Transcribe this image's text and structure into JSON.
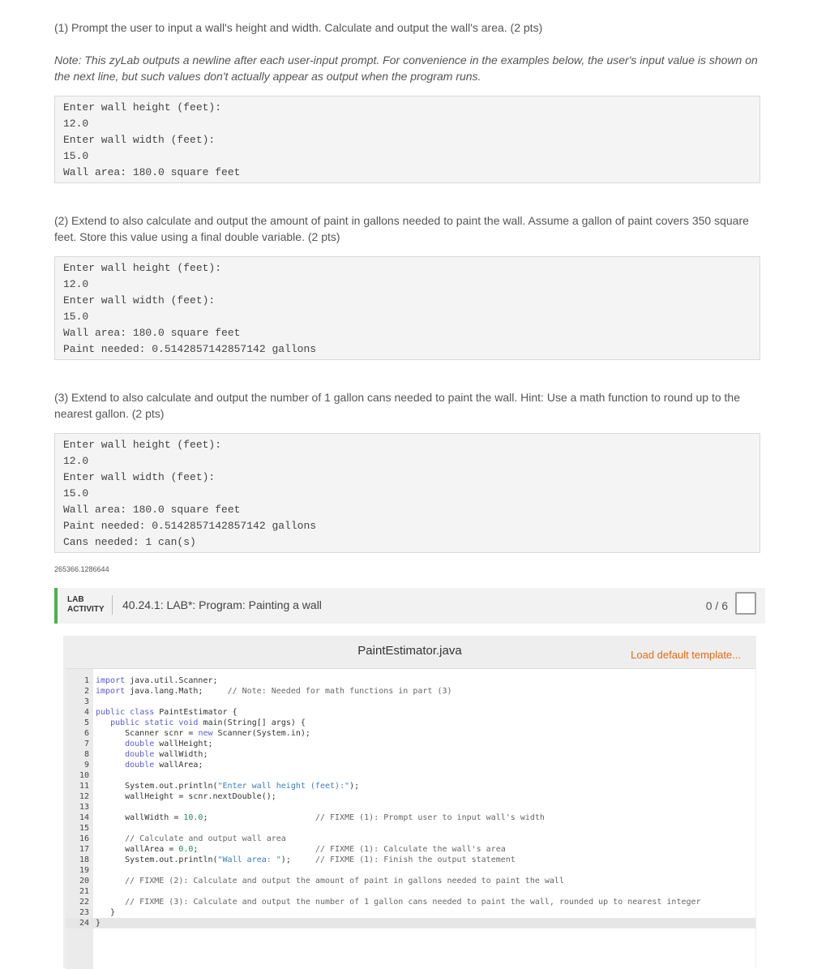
{
  "part1": {
    "text": "(1) Prompt the user to input a wall's height and width. Calculate and output the wall's area. (2 pts)",
    "note": "Note: This zyLab outputs a newline after each user-input prompt. For convenience in the examples below, the user's input value is shown on the next line, but such values don't actually appear as output when the program runs.",
    "output": [
      "Enter wall height (feet):",
      "12.0",
      "Enter wall width (feet):",
      "15.0",
      "Wall area: 180.0 square feet"
    ]
  },
  "part2": {
    "text": "(2) Extend to also calculate and output the amount of paint in gallons needed to paint the wall. Assume a gallon of paint covers 350 square feet. Store this value using a final double variable. (2 pts)",
    "output": [
      "Enter wall height (feet):",
      "12.0",
      "Enter wall width (feet):",
      "15.0",
      "Wall area: 180.0 square feet",
      "Paint needed: 0.5142857142857142 gallons"
    ]
  },
  "part3": {
    "text": "(3) Extend to also calculate and output the number of 1 gallon cans needed to paint the wall. Hint: Use a math function to round up to the nearest gallon. (2 pts)",
    "output": [
      "Enter wall height (feet):",
      "12.0",
      "Enter wall width (feet):",
      "15.0",
      "Wall area: 180.0 square feet",
      "Paint needed: 0.5142857142857142 gallons",
      "Cans needed: 1 can(s)"
    ]
  },
  "lab_id": "265366.1286644",
  "lab": {
    "tag_line1": "LAB",
    "tag_line2": "ACTIVITY",
    "title": "40.24.1: LAB*: Program: Painting a wall",
    "score": "0 / 6"
  },
  "editor": {
    "filename": "PaintEstimator.java",
    "load_template": "Load default template...",
    "code": [
      "import java.util.Scanner;",
      "import java.lang.Math;     // Note: Needed for math functions in part (3)",
      "",
      "public class PaintEstimator {",
      "   public static void main(String[] args) {",
      "      Scanner scnr = new Scanner(System.in);",
      "      double wallHeight;",
      "      double wallWidth;",
      "      double wallArea;",
      "",
      "      System.out.println(\"Enter wall height (feet):\");",
      "      wallHeight = scnr.nextDouble();",
      "",
      "      wallWidth = 10.0;                      // FIXME (1): Prompt user to input wall's width",
      "",
      "      // Calculate and output wall area",
      "      wallArea = 0.0;                        // FIXME (1): Calculate the wall's area",
      "      System.out.println(\"Wall area: \");     // FIXME (1): Finish the output statement",
      "",
      "      // FIXME (2): Calculate and output the amount of paint in gallons needed to paint the wall",
      "",
      "      // FIXME (3): Calculate and output the number of 1 gallon cans needed to paint the wall, rounded up to nearest integer",
      "   }",
      "}"
    ]
  }
}
